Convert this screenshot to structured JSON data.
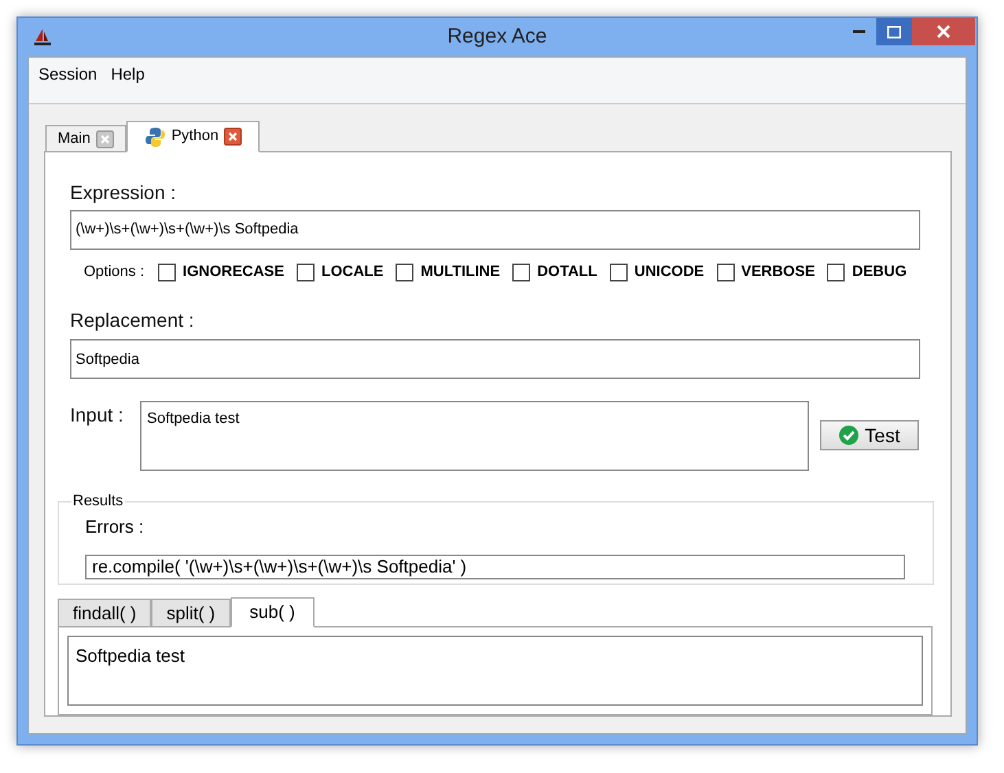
{
  "window": {
    "title": "Regex Ace"
  },
  "menu": [
    "Session",
    "Help"
  ],
  "tabs": [
    {
      "label": "Main",
      "selected": false,
      "icon": false
    },
    {
      "label": "Python",
      "selected": true,
      "icon": true
    }
  ],
  "expression": {
    "label": "Expression :",
    "value": "(\\w+)\\s+(\\w+)\\s+(\\w+)\\s Softpedia"
  },
  "options": {
    "label": "Options :",
    "items": [
      {
        "label": "IGNORECASE",
        "checked": false
      },
      {
        "label": "LOCALE",
        "checked": false
      },
      {
        "label": "MULTILINE",
        "checked": false
      },
      {
        "label": "DOTALL",
        "checked": false
      },
      {
        "label": "UNICODE",
        "checked": false
      },
      {
        "label": "VERBOSE",
        "checked": false
      },
      {
        "label": "DEBUG",
        "checked": false
      }
    ]
  },
  "replacement": {
    "label": "Replacement :",
    "value": "Softpedia"
  },
  "input": {
    "label": "Input :",
    "value": "Softpedia test"
  },
  "test_button": "Test",
  "results": {
    "title": "Results",
    "errors_label": "Errors :",
    "compile": "re.compile( '(\\w+)\\s+(\\w+)\\s+(\\w+)\\s Softpedia' )",
    "tabs": [
      {
        "label": "findall( )",
        "selected": false
      },
      {
        "label": "split( )",
        "selected": false
      },
      {
        "label": "sub( )",
        "selected": true
      }
    ],
    "output": "Softpedia test"
  }
}
